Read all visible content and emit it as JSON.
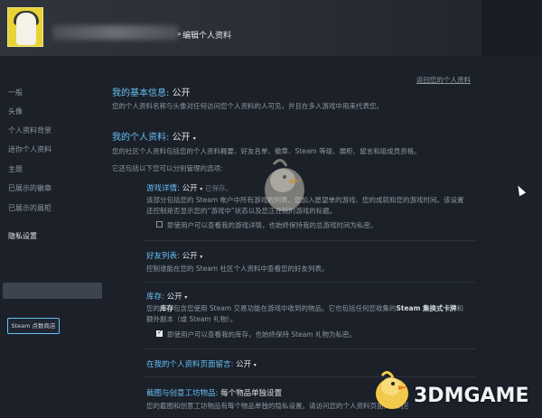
{
  "header": {
    "separator": "»",
    "breadcrumb": "编辑个人资料"
  },
  "sidebar": {
    "items": [
      {
        "label": "一般"
      },
      {
        "label": "头像"
      },
      {
        "label": "个人资料背景"
      },
      {
        "label": "迷你个人资料"
      },
      {
        "label": "主题"
      },
      {
        "label": "已展示的徽章"
      },
      {
        "label": "已展示的展柜"
      },
      {
        "label": "隐私设置"
      }
    ],
    "store_button": "Steam 点数商店"
  },
  "main": {
    "return_link": "返回您的个人资料",
    "basic_info": {
      "title": "我的基本信息:",
      "value": "公开",
      "desc": "您的个人资料名称与头像对任何访问您个人资料的人可见，并且在多人游戏中用来代表您。"
    },
    "profile": {
      "title": "我的个人资料:",
      "value": "公开",
      "chevron": "▾",
      "desc1": "您的社区个人资料包括您的个人资料概要、好友名单、徽章、Steam 等级、展柜、留言和组成员资格。",
      "desc2": "它还包括以下您可以分别管理的选项:"
    },
    "game_details": {
      "title": "游戏详情:",
      "value": "公开",
      "chevron": "▾",
      "saved": "已保存。",
      "desc1": "该部分包括您的 Steam 帐户中所有游戏的列表、您加入愿望单的游戏、您的成就和您的游戏时间。该设置",
      "desc2": "还控制是否显示您的“游戏中”状态以及您正在玩的游戏的标题。",
      "checkbox_label": "即使用户可以查看我的游戏详情，也始终保持我的总游戏时间为私密。",
      "checked": false
    },
    "friends": {
      "title": "好友列表:",
      "value": "公开",
      "chevron": "▾",
      "desc": "控制谁能在您的 Steam 社区个人资料中查看您的好友列表。"
    },
    "inventory": {
      "title": "库存:",
      "value": "公开",
      "chevron": "▾",
      "desc1_a": "您的",
      "desc1_b": "库存",
      "desc1_c": "包含您使用 Steam 交易功能在游戏中收到的物品。它也包括任何您收集的",
      "desc1_d": "Steam 集换式卡牌",
      "desc1_e": "和",
      "desc2": "额外副本（或 Steam 礼物）。",
      "checkbox_label": "即使用户可以查看我的库存，也始终保持 Steam 礼物为私密。",
      "checked": true
    },
    "comments": {
      "title": "在我的个人资料页面留言:",
      "value": "公开",
      "chevron": "▾"
    },
    "screenshots": {
      "title": "截图与创意工坊物品:",
      "value": "每个物品单独设置",
      "desc": "您的截图和创意工坊物品有每个物品单独的隐私设置。请访问您的个人资料页面，在对应的页面进行设置。"
    }
  },
  "watermark": {
    "text": "3DMGAME"
  }
}
